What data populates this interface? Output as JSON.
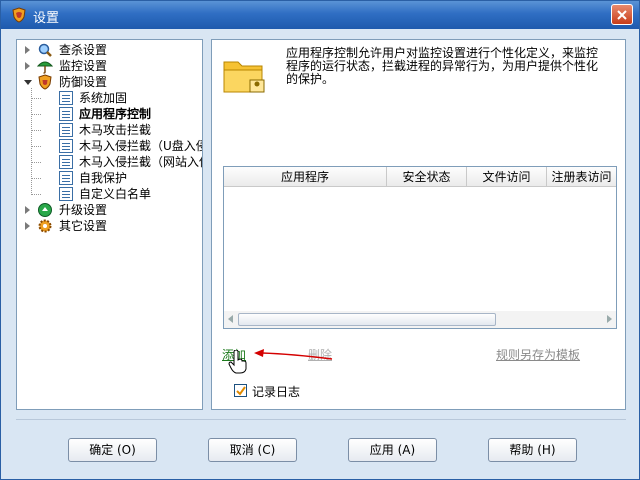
{
  "window": {
    "title": "设置"
  },
  "tree": {
    "items": [
      {
        "label": "查杀设置",
        "level": 0,
        "expanded": false
      },
      {
        "label": "监控设置",
        "level": 0,
        "expanded": false
      },
      {
        "label": "防御设置",
        "level": 0,
        "expanded": true
      },
      {
        "label": "系统加固",
        "level": 1
      },
      {
        "label": "应用程序控制",
        "level": 1,
        "selected": true
      },
      {
        "label": "木马攻击拦截",
        "level": 1
      },
      {
        "label": "木马入侵拦截（U盘入侵",
        "level": 1
      },
      {
        "label": "木马入侵拦截（网站入侵",
        "level": 1
      },
      {
        "label": "自我保护",
        "level": 1
      },
      {
        "label": "自定义白名单",
        "level": 1
      },
      {
        "label": "升级设置",
        "level": 0,
        "expanded": false
      },
      {
        "label": "其它设置",
        "level": 0,
        "expanded": false
      }
    ]
  },
  "content": {
    "description": "应用程序控制允许用户对监控设置进行个性化定义，来监控程序的运行状态，拦截进程的异常行为，为用户提供个性化的保护。",
    "table": {
      "columns": [
        "应用程序",
        "安全状态",
        "文件访问",
        "注册表访问"
      ],
      "rows": []
    },
    "add_label": "添加",
    "delete_label": "删除",
    "save_template_label": "规则另存为模板",
    "log_label": "记录日志",
    "log_checked": true
  },
  "buttons": {
    "ok": "确定 (O)",
    "cancel": "取消 (C)",
    "apply": "应用 (A)",
    "help": "帮助 (H)"
  },
  "colors": {
    "titlebar": "#2f6ec3",
    "window_bg": "#d9e6f3",
    "add_link": "#1c7a1c",
    "annotation_arrow": "#d40000"
  }
}
